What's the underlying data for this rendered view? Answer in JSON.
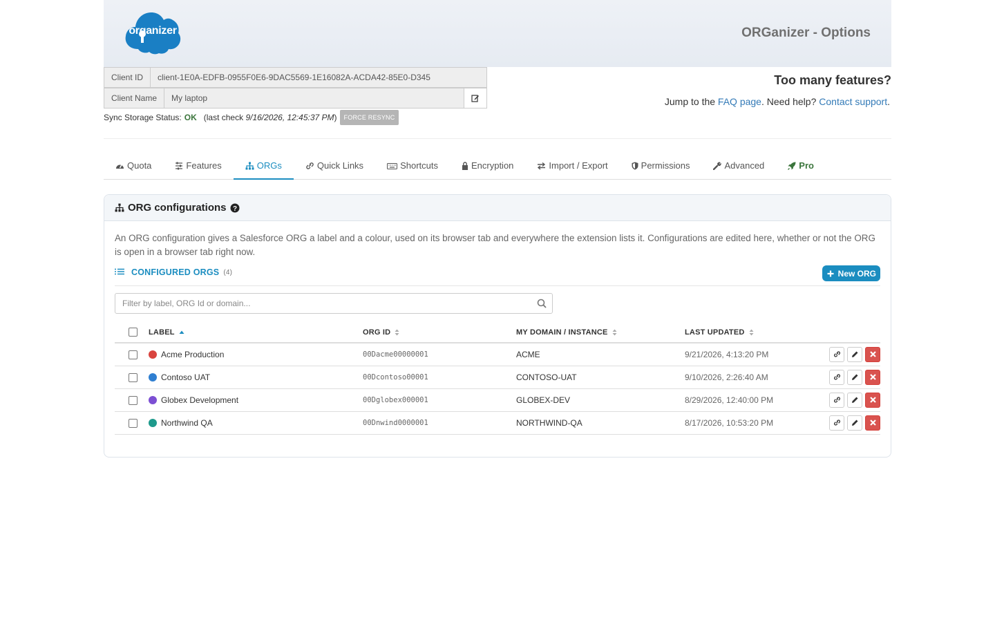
{
  "header": {
    "logo_text": "organizer",
    "title": "ORGanizer - Options"
  },
  "client": {
    "id_label": "Client ID",
    "id_value": "client-1E0A-EDFB-0955F0E6-9DAC5569-1E16082A-ACDA42-85E0-D345",
    "name_label": "Client Name",
    "name_value": "My laptop",
    "sync_label": "Sync Storage Status:",
    "sync_status": "OK",
    "last_check_prefix": "(last check",
    "last_check_value": "9/16/2026, 12:45:37 PM",
    "last_check_suffix": ")",
    "resync_label": "FORCE RESYNC"
  },
  "help": {
    "heading": "Too many features?",
    "text_1": "Jump to the ",
    "faq_link": "FAQ page",
    "text_2": ". Need help? ",
    "contact_link": "Contact support",
    "text_3": "."
  },
  "tabs": [
    {
      "label": "Quota",
      "icon": "dashboard-icon"
    },
    {
      "label": "Features",
      "icon": "sliders-icon"
    },
    {
      "label": "ORGs",
      "icon": "sitemap-icon"
    },
    {
      "label": "Quick Links",
      "icon": "link-icon"
    },
    {
      "label": "Shortcuts",
      "icon": "keyboard-icon"
    },
    {
      "label": "Encryption",
      "icon": "lock-icon"
    },
    {
      "label": "Import / Export",
      "icon": "exchange-icon"
    },
    {
      "label": "Permissions",
      "icon": "shield-icon"
    },
    {
      "label": "Advanced",
      "icon": "wrench-icon"
    },
    {
      "label": "Pro",
      "icon": "rocket-icon"
    }
  ],
  "active_tab": "ORGs",
  "panel": {
    "title": "ORG configurations",
    "description": "An ORG configuration gives a Salesforce ORG a label and a colour, used on its browser tab and everywhere the extension lists it. Configurations are edited here, whether or not the ORG is open in a browser tab right now.",
    "section_title": "CONFIGURED ORGS",
    "section_count": "(4)",
    "new_button": "New ORG",
    "filter_placeholder": "Filter by label, ORG Id or domain..."
  },
  "table": {
    "columns": [
      "LABEL",
      "ORG ID",
      "MY DOMAIN / INSTANCE",
      "LAST UPDATED"
    ],
    "rows": [
      {
        "label": "Acme Production",
        "color": "#d9443f",
        "org_id": "00Dacme00000001",
        "domain": "ACME",
        "updated": "9/21/2026, 4:13:20 PM"
      },
      {
        "label": "Contoso UAT",
        "color": "#2f7fd1",
        "org_id": "00Dcontoso00001",
        "domain": "CONTOSO-UAT",
        "updated": "9/10/2026, 2:26:40 AM"
      },
      {
        "label": "Globex Development",
        "color": "#7c4fd3",
        "org_id": "00Dglobex000001",
        "domain": "GLOBEX-DEV",
        "updated": "8/29/2026, 12:40:00 PM"
      },
      {
        "label": "Northwind QA",
        "color": "#1e9a8c",
        "org_id": "00Dnwind0000001",
        "domain": "NORTHWIND-QA",
        "updated": "8/17/2026, 10:53:20 PM"
      }
    ]
  },
  "colors": {
    "accent": "#1b8dc0",
    "ok": "#3c763d",
    "danger": "#d9534f",
    "pro": "#3c763d"
  }
}
